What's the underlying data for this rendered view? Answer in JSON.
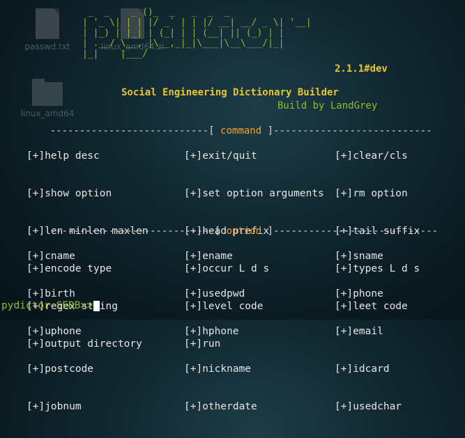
{
  "desktop": {
    "icons": [
      {
        "label": "passwd.txt"
      },
      {
        "label": "linux_amd64.zi"
      },
      {
        "label": "linux_amd64"
      }
    ]
  },
  "terminal": {
    "logo_ascii": " _  _    _ ()_  _   _  _  _ \n| '_ \\| | | |/ _` | | |/ __| __/ _ \\| '__|\n| |_) | |_| | (_| | | (__| || (_) | |   \n| .__/ \\__, |\\__,_|_|\\___|\\__\\___/|_|   \n|_|    |___/                            ",
    "version": "2.1.1#dev",
    "subtitle": "Social Engineering Dictionary Builder",
    "build_by": "Build by LandGrey",
    "command_section": {
      "sep_left": "---------------------------[ ",
      "label": "command",
      "sep_right": " ]---------------------------",
      "rows": [
        [
          "[+]help desc",
          "[+]exit/quit",
          "[+]clear/cls"
        ],
        [
          "[+]show option",
          "[+]set option arguments",
          "[+]rm option"
        ],
        [
          "[+]len minlen maxlen",
          "[+]head prefix",
          "[+]tail suffix"
        ],
        [
          "[+]encode type",
          "[+]occur L d s",
          "[+]types L d s"
        ],
        [
          "[+]regex string",
          "[+]level code",
          "[+]leet code"
        ],
        [
          "[+]output directory",
          "[+]run",
          ""
        ]
      ]
    },
    "option_section": {
      "sep_left": "----------------------------[ ",
      "label": "option",
      "sep_right": " ]----------------------------",
      "rows": [
        [
          "[+]cname",
          "[+]ename",
          "[+]sname"
        ],
        [
          "[+]birth",
          "[+]usedpwd",
          "[+]phone"
        ],
        [
          "[+]uphone",
          "[+]hphone",
          "[+]email"
        ],
        [
          "[+]postcode",
          "[+]nickname",
          "[+]idcard"
        ],
        [
          "[+]jobnum",
          "[+]otherdate",
          "[+]usedchar"
        ]
      ]
    },
    "prompt": "pydictor SEDB>>"
  },
  "colors": {
    "green": "#93bb2f",
    "yellow": "#e8c534",
    "orange": "#e8a13a",
    "text": "#e6e6e6",
    "background": "#0b1b22"
  }
}
